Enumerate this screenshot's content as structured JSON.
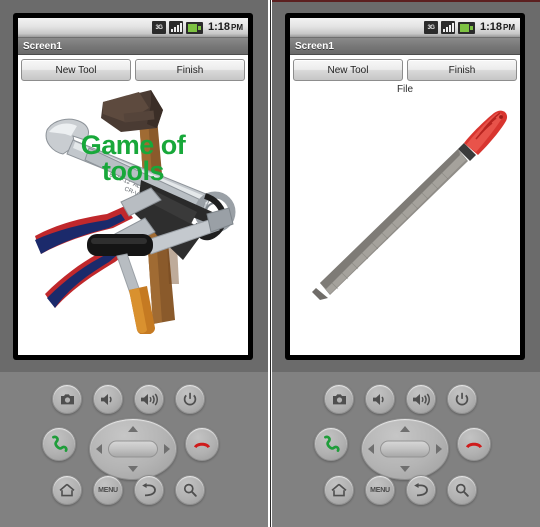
{
  "app": {
    "window_title": "Screen1",
    "status_bar": {
      "network_label": "3G",
      "time": "1:18",
      "ampm": "PM",
      "icons": [
        "3g-icon",
        "signal-strength-icon",
        "battery-icon"
      ]
    },
    "buttons": {
      "new_tool": "New Tool",
      "finish": "Finish"
    }
  },
  "panels": [
    {
      "id": "left",
      "title": "Screen1",
      "new_tool_label": "New Tool",
      "finish_label": "Finish",
      "caption": "",
      "overlay_line1": "Game of",
      "overlay_line2": "tools",
      "overlay_color": "#18a83a",
      "image_name": "assorted-hand-tools-photo",
      "image_alt": "Hammer, adjustable wrench, combination wrench, pliers and screwdriver"
    },
    {
      "id": "right",
      "title": "Screen1",
      "new_tool_label": "New Tool",
      "finish_label": "Finish",
      "caption": "File",
      "overlay_line1": "",
      "overlay_line2": "",
      "overlay_color": "#18a83a",
      "image_name": "metal-file-photo",
      "image_alt": "Metal hand file with red plastic handle"
    }
  ],
  "hardware_keys": {
    "row1": [
      {
        "name": "camera-button",
        "label": ""
      },
      {
        "name": "volume-down-button",
        "label": ""
      },
      {
        "name": "volume-up-button",
        "label": ""
      },
      {
        "name": "power-button",
        "label": ""
      }
    ],
    "row2": [
      {
        "name": "call-button",
        "label": ""
      },
      {
        "name": "dpad",
        "label": ""
      },
      {
        "name": "end-call-button",
        "label": ""
      }
    ],
    "row3": [
      {
        "name": "home-button",
        "label": ""
      },
      {
        "name": "menu-button",
        "label": "MENU"
      },
      {
        "name": "back-button",
        "label": ""
      },
      {
        "name": "search-button",
        "label": ""
      }
    ]
  },
  "colors": {
    "body": "#6b6b6b",
    "body_lower": "#818181",
    "titlebar": "#787878",
    "screen": "#ffffff",
    "battery_green": "#7dc242",
    "call_green": "#1f9d3a",
    "endcall_red": "#cf1b1b",
    "top_accent": "#5c2020"
  }
}
